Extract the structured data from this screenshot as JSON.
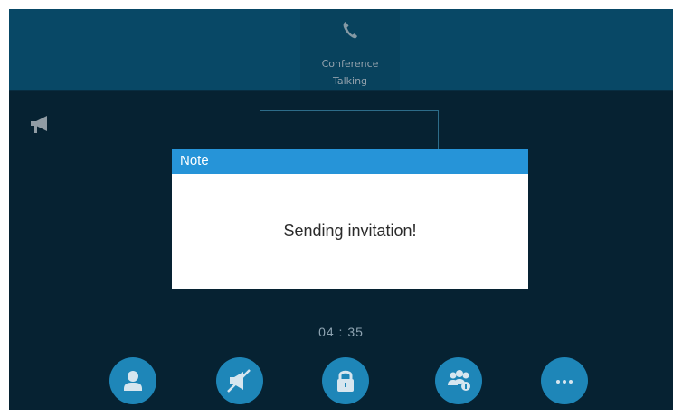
{
  "call_tab": {
    "icon": "phone-icon",
    "title": "Conference",
    "status": "Talking"
  },
  "status_icons": {
    "speaker": "speakerphone-icon"
  },
  "dialog": {
    "title": "Note",
    "message": "Sending invitation!"
  },
  "call": {
    "duration": "04 : 35"
  },
  "softkeys": [
    {
      "icon": "contact-icon"
    },
    {
      "icon": "mute-icon"
    },
    {
      "icon": "lock-icon"
    },
    {
      "icon": "conference-manage-icon"
    },
    {
      "icon": "more-icon"
    }
  ],
  "colors": {
    "background": "#082a3e",
    "top_bar": "#0b5f86",
    "dialog_header": "#2694d8",
    "softkey": "#1e86b8"
  }
}
